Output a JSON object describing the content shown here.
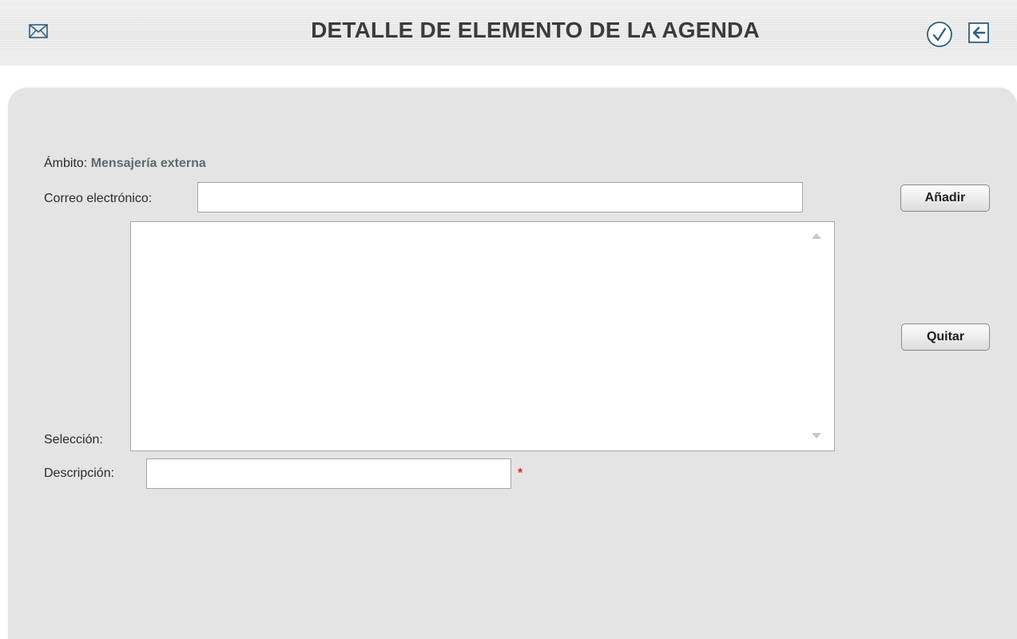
{
  "header": {
    "title": "DETALLE DE ELEMENTO DE LA AGENDA",
    "icons": {
      "left": "envelope-icon",
      "confirm": "checkmark-circle-icon",
      "back": "arrow-left-box-icon"
    }
  },
  "form": {
    "ambito_label": "Ámbito:",
    "ambito_value": "Mensajería externa",
    "email_label": "Correo electrónico:",
    "email_value": "",
    "seleccion_label": "Selección:",
    "descripcion_label": "Descripción:",
    "descripcion_value": "",
    "required_marker": "*",
    "add_button": "Añadir",
    "remove_button": "Quitar"
  },
  "colors": {
    "panel_bg": "#e4e4e4",
    "title_text": "#3b3b3b",
    "ambito_value": "#5d6b70",
    "required": "#d62a2a",
    "icon": "#355e7a"
  }
}
